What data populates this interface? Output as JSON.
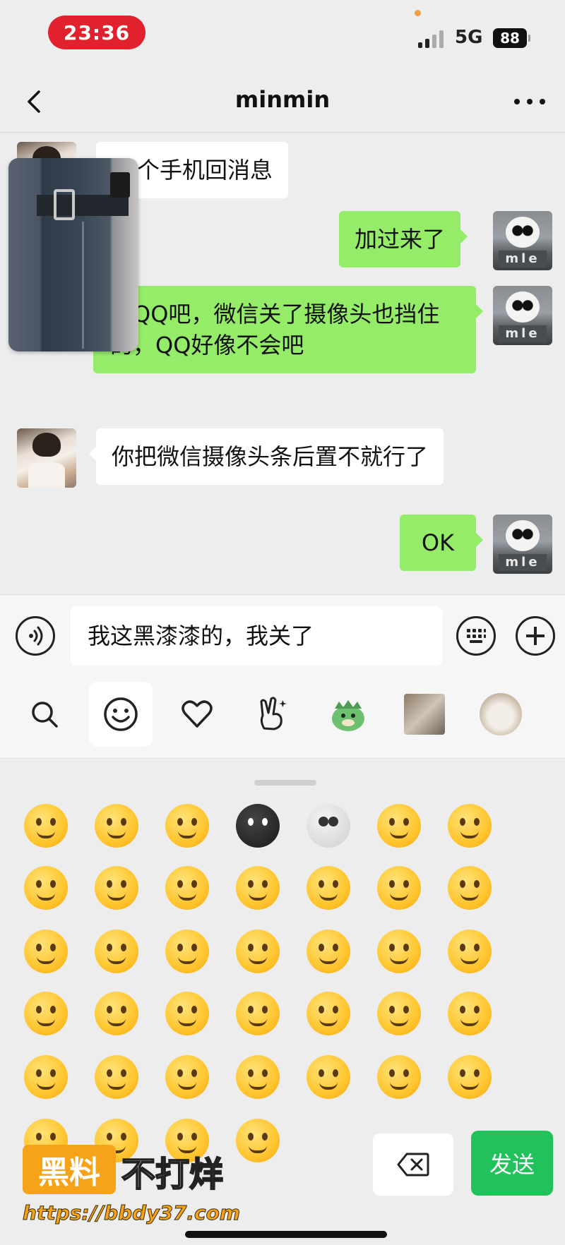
{
  "status_bar": {
    "time": "23:36",
    "network": "5G",
    "battery": "88"
  },
  "nav": {
    "title": "minmin",
    "back_icon": "chevron-left-icon",
    "more_icon": "more-dots-icon"
  },
  "messages": [
    {
      "side": "in",
      "text": "个手机回消息"
    },
    {
      "side": "out",
      "text": "加过来了"
    },
    {
      "side": "out",
      "text": "不QQ吧，微信关了摄像头也挡住的，QQ好像不会吧"
    },
    {
      "side": "in",
      "text": "你把微信摄像头条后置不就行了"
    },
    {
      "side": "out",
      "text": "OK"
    }
  ],
  "input": {
    "value": "我这黑漆漆的，我关了",
    "voice_icon": "voice-icon",
    "keyboard_icon": "keyboard-icon",
    "plus_icon": "plus-icon"
  },
  "sticker_tabs": [
    {
      "icon": "search-icon"
    },
    {
      "icon": "smiley-icon",
      "active": true
    },
    {
      "icon": "heart-icon"
    },
    {
      "icon": "victory-hand-icon"
    },
    {
      "icon": "dinosaur-sticker-icon"
    },
    {
      "icon": "cat-sticker-icon"
    },
    {
      "icon": "cat-face-sticker-icon"
    }
  ],
  "emoji_panel": {
    "delete_icon": "backspace-icon",
    "send_label": "发送"
  },
  "watermark": {
    "badge": "黑料",
    "slogan": "不打烊",
    "url": "https://bbdy37.com"
  },
  "colors": {
    "outgoing_bubble": "#95ec69",
    "send_button": "#21c15c",
    "time_pill": "#e2212f"
  }
}
